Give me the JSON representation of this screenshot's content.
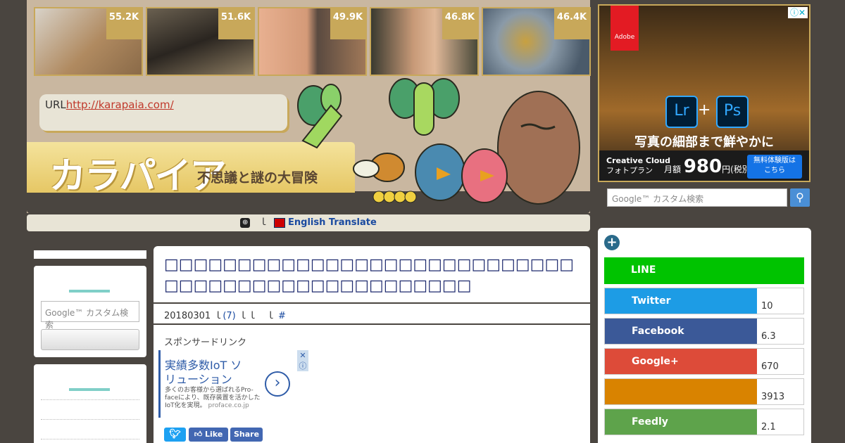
{
  "colors": {
    "accent_gold": "#c8a85a",
    "background": "#4a4540",
    "header": "#c9b7a0",
    "title_blue": "#1e2a6e"
  },
  "header": {
    "thumbnails": [
      {
        "count": "55.2K",
        "icon": "cats-image"
      },
      {
        "count": "51.6K",
        "icon": "dog-image"
      },
      {
        "count": "49.9K",
        "icon": "man-faces-image"
      },
      {
        "count": "46.8K",
        "icon": "woman-face-image"
      },
      {
        "count": "46.4K",
        "icon": "rock-image"
      }
    ],
    "url_prefix": "URL",
    "url_link": "http://karapaia.com/",
    "logo_text": "カラパイア",
    "tagline": "不思議と謎の大冒険"
  },
  "translate": {
    "separator": "ｌ",
    "label": "English Translate"
  },
  "ad": {
    "brand": "Adobe",
    "close_icon": "ⓘ✕",
    "app1": "Lr",
    "app2": "Ps",
    "plus": "+",
    "headline": "写真の細部まで鮮やかに",
    "product_line1": "Creative Cloud",
    "product_line2": "フォトプラン",
    "price_prefix": "月額",
    "price": "980",
    "price_suffix": "円(税別)",
    "trial_line1": "無料体験版は",
    "trial_line2": "こちら"
  },
  "search": {
    "placeholder": "Google™ カスタム検索"
  },
  "share": {
    "buttons": [
      {
        "label": "LINE",
        "count": "",
        "color": "#00c300"
      },
      {
        "label": "Twitter",
        "count": "10",
        "color": "#1d9ce5"
      },
      {
        "label": "Facebook",
        "count": "6.3",
        "color": "#3b5998"
      },
      {
        "label": "Google+",
        "count": "670",
        "color": "#dd4b39"
      },
      {
        "label": "",
        "count": "3913",
        "color": "#d98300"
      },
      {
        "label": "Feedly",
        "count": "2.1",
        "color": "#5ea34b"
      }
    ]
  },
  "article": {
    "title": "□□□□□□□□□□□□□□□□□□□□□□□□□□□□□□□□□□□□□□□□□□□□□□□□□",
    "date": "20180301",
    "separator": "ｌ",
    "comments": "(7)",
    "sep2": "ｌｌ　ｌ",
    "hash": "#",
    "sponsor": "スポンサードリンク",
    "ad_headline": "実績多数IoT ソリューション",
    "ad_sub": "多くのお客様から選ばれるPro-faceにより、既存装置を活かしたIoT化を実現。",
    "ad_domain": "proface.co.jp",
    "ad_arrow": "›",
    "ad_x": "✕",
    "ad_i": "ⓘ",
    "tweet_icon": "twitter-bird-icon",
    "like_label": "Like",
    "share_label": "Share"
  }
}
